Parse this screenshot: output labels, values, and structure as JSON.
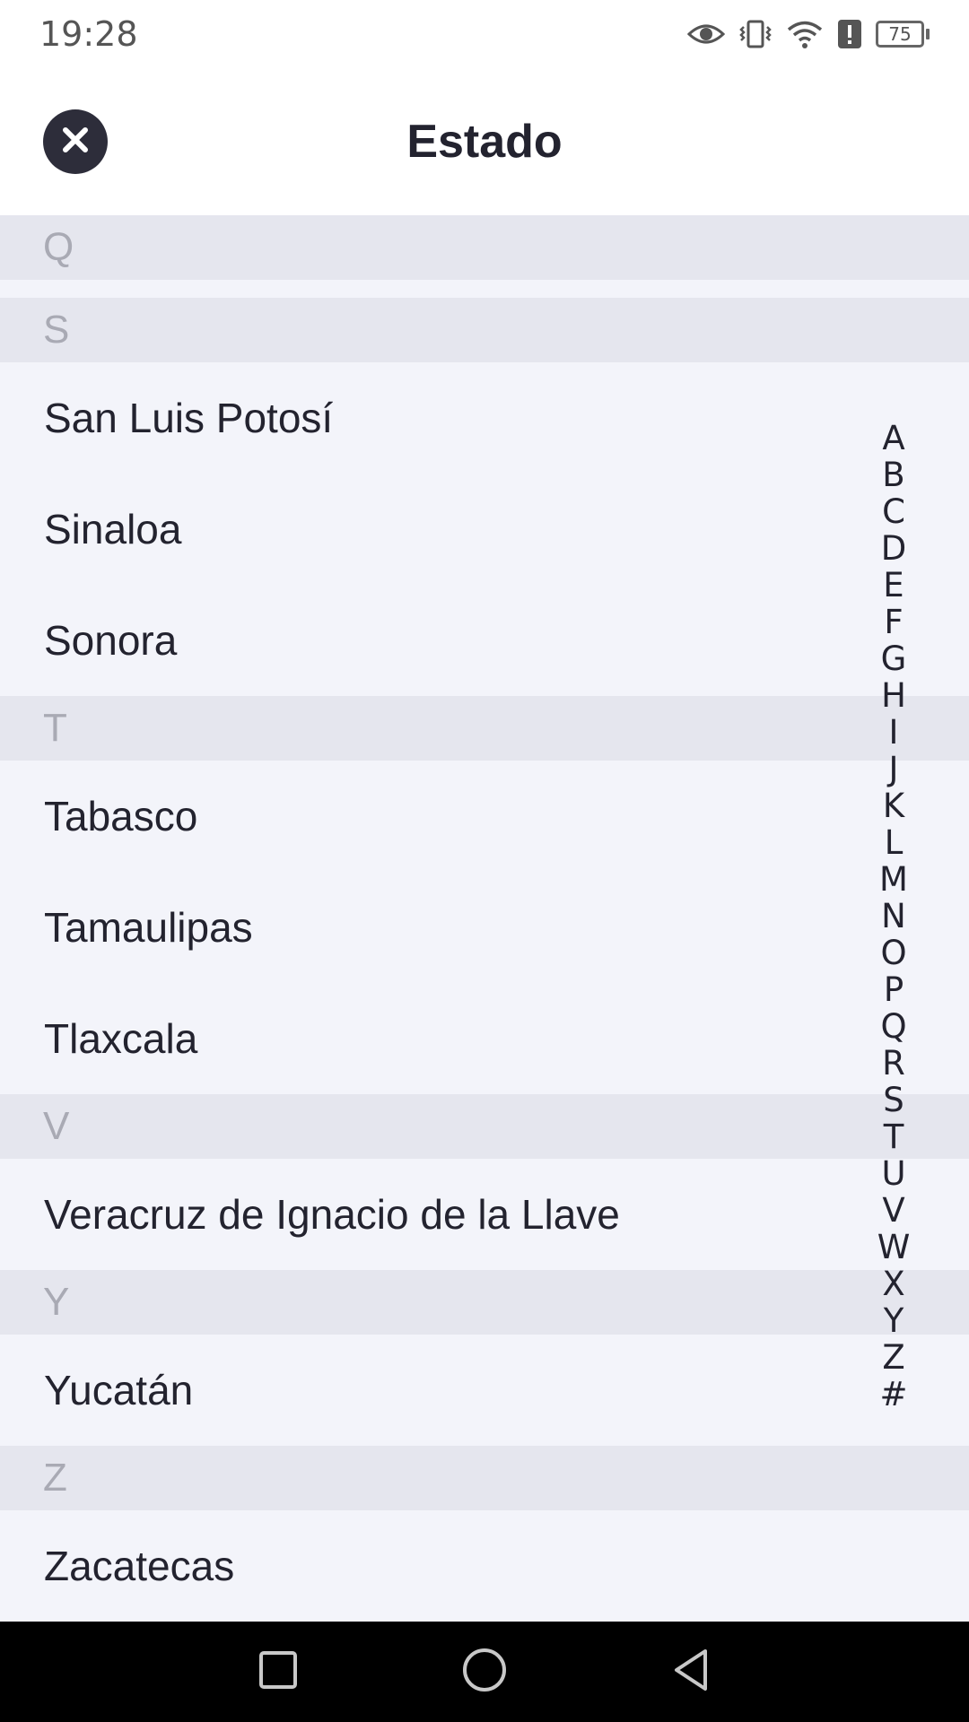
{
  "status_bar": {
    "time": "19:28",
    "battery": "75",
    "icons": [
      "eye-icon",
      "vibrate-icon",
      "wifi-icon",
      "alert-icon",
      "battery-icon"
    ]
  },
  "header": {
    "title": "Estado",
    "close_icon": "close-icon"
  },
  "list": {
    "sections": [
      {
        "letter": "Q",
        "items": []
      },
      {
        "letter": "S",
        "items": [
          "San Luis Potosí",
          "Sinaloa",
          "Sonora"
        ]
      },
      {
        "letter": "T",
        "items": [
          "Tabasco",
          "Tamaulipas",
          "Tlaxcala"
        ]
      },
      {
        "letter": "V",
        "items": [
          "Veracruz de Ignacio de la Llave"
        ]
      },
      {
        "letter": "Y",
        "items": [
          "Yucatán"
        ]
      },
      {
        "letter": "Z",
        "items": [
          "Zacatecas"
        ]
      }
    ]
  },
  "alphabet_index": [
    "A",
    "B",
    "C",
    "D",
    "E",
    "F",
    "G",
    "H",
    "I",
    "J",
    "K",
    "L",
    "M",
    "N",
    "O",
    "P",
    "Q",
    "R",
    "S",
    "T",
    "U",
    "V",
    "W",
    "X",
    "Y",
    "Z",
    "#"
  ],
  "nav_bar": {
    "buttons": [
      "recents-square-icon",
      "home-circle-icon",
      "back-triangle-icon"
    ]
  },
  "colors": {
    "header_bg": "#ffffff",
    "list_bg": "#f3f4fa",
    "section_bg": "#e5e6ee",
    "section_text": "#a9aab4",
    "text_dark": "#23232f",
    "close_bg": "#2d2d3a"
  }
}
